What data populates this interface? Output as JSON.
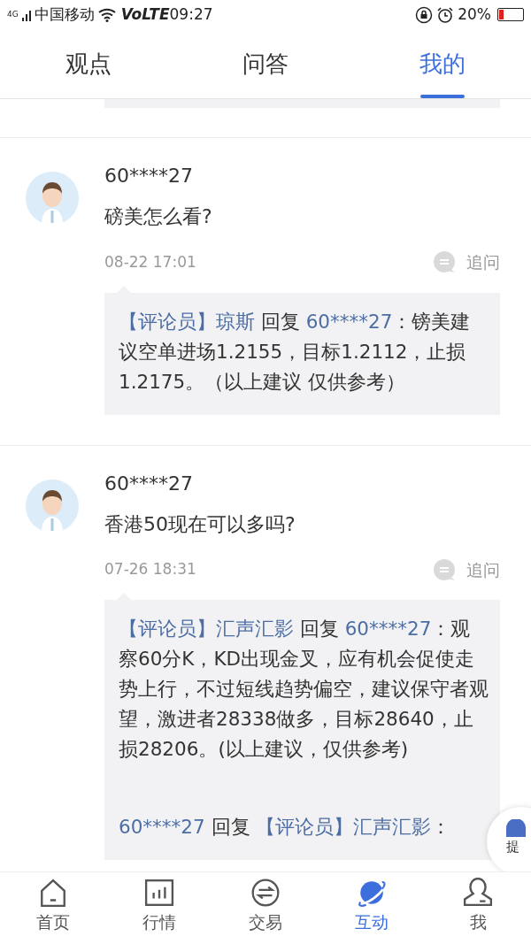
{
  "status_bar": {
    "network": "4G",
    "carrier": "中国移动",
    "volte": "VoLTE",
    "time": "09:27",
    "battery_text": "20%",
    "battery": {
      "level": 0.2
    }
  },
  "tabs": [
    {
      "label": "观点",
      "selected": false
    },
    {
      "label": "问答",
      "selected": false
    },
    {
      "label": "我的",
      "selected": true
    }
  ],
  "posts": [
    {
      "user": "60****27",
      "question": "磅美怎么看?",
      "time": "08-22 17:01",
      "action": "追问",
      "replies": [
        [
          {
            "kind": "name",
            "text": "【评论员】琼斯"
          },
          {
            "kind": "text",
            "text": " 回复 "
          },
          {
            "kind": "name",
            "text": "60****27"
          },
          {
            "kind": "text",
            "text": "：镑美建议空单进场1.2155，目标1.2112，止损1.2175。（以上建议 仅供参考）"
          }
        ]
      ]
    },
    {
      "user": "60****27",
      "question": "香港50现在可以多吗?",
      "time": "07-26 18:31",
      "action": "追问",
      "replies": [
        [
          {
            "kind": "name",
            "text": "【评论员】汇声汇影"
          },
          {
            "kind": "text",
            "text": " 回复 "
          },
          {
            "kind": "name",
            "text": "60****27"
          },
          {
            "kind": "text",
            "text": "：观察60分K，KD出现金叉，应有机会促使走势上行，不过短线趋势偏空，建议保守者观望，激进者28338做多，目标28640，止损28206。(以上建议，仅供参考)"
          }
        ],
        [
          {
            "kind": "name",
            "text": "60****27"
          },
          {
            "kind": "text",
            "text": " 回复 "
          },
          {
            "kind": "name",
            "text": "【评论员】汇声汇影"
          },
          {
            "kind": "text",
            "text": "："
          }
        ]
      ]
    }
  ],
  "float_button": {
    "label": "提"
  },
  "bottom_nav": [
    {
      "kind": "home",
      "label": "首页",
      "selected": false
    },
    {
      "kind": "chart",
      "label": "行情",
      "selected": false
    },
    {
      "kind": "trade",
      "label": "交易",
      "selected": false
    },
    {
      "kind": "planet",
      "label": "互动",
      "selected": true
    },
    {
      "kind": "person",
      "label": "我",
      "selected": false
    }
  ]
}
